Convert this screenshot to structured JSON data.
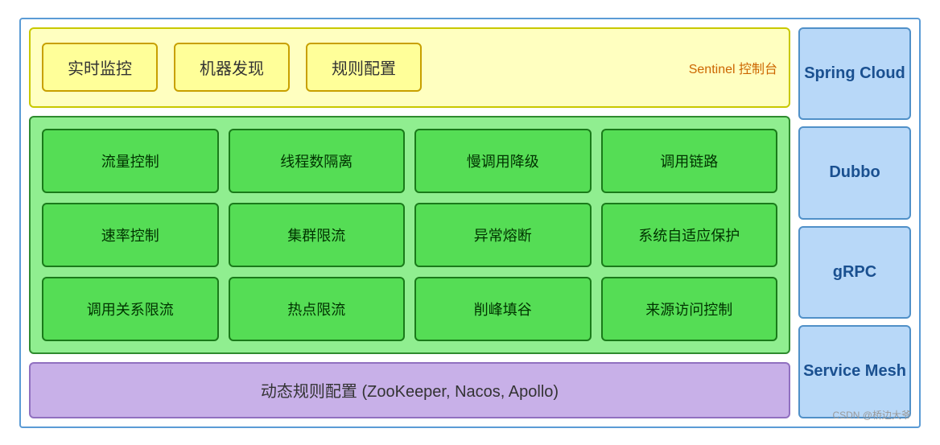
{
  "sentinel": {
    "box1": "实时监控",
    "box2": "机器发现",
    "box3": "规则配置",
    "label": "Sentinel 控制台"
  },
  "grid": {
    "cells": [
      "流量控制",
      "线程数隔离",
      "慢调用降级",
      "调用链路",
      "速率控制",
      "集群限流",
      "异常熔断",
      "系统自适应保护",
      "调用关系限流",
      "热点限流",
      "削峰填谷",
      "来源访问控制"
    ]
  },
  "bottom": {
    "label": "动态规则配置 (ZooKeeper, Nacos, Apollo)"
  },
  "sidebar": {
    "items": [
      "Spring Cloud",
      "Dubbo",
      "gRPC",
      "Service Mesh"
    ]
  },
  "watermark": "CSDN @桥边大爷"
}
